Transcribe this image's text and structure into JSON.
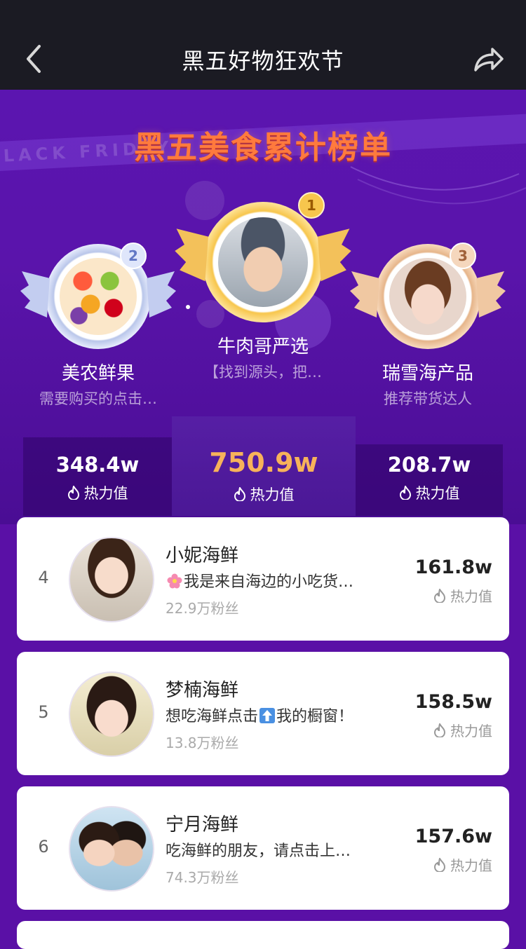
{
  "nav": {
    "title": "黑五好物狂欢节",
    "back_icon": "chevron-left-icon",
    "share_icon": "share-icon"
  },
  "hero": {
    "title": "黑五美食累计榜单",
    "banner_text": "BLACK FRIDAY",
    "podium": [
      {
        "rank": "2",
        "name": "美农鲜果",
        "desc": "需要购买的点击…"
      },
      {
        "rank": "1",
        "name": "牛肉哥严选",
        "desc": "【找到源头，把…"
      },
      {
        "rank": "3",
        "name": "瑞雪海产品",
        "desc": "推荐带货达人"
      }
    ]
  },
  "stats": [
    {
      "value": "348.4w",
      "label": "热力值"
    },
    {
      "value": "750.9w",
      "label": "热力值"
    },
    {
      "value": "208.7w",
      "label": "热力值"
    }
  ],
  "list": [
    {
      "rank": "4",
      "name": "小妮海鲜",
      "desc_prefix": "",
      "desc": "我是来自海边的小吃货…",
      "fans": "22.9万粉丝",
      "heat": "161.8w",
      "heat_label": "热力值"
    },
    {
      "rank": "5",
      "name": "梦楠海鲜",
      "desc": "想吃海鲜点击",
      "desc_after": "我的橱窗！",
      "fans": "13.8万粉丝",
      "heat": "158.5w",
      "heat_label": "热力值"
    },
    {
      "rank": "6",
      "name": "宁月海鲜",
      "desc": "吃海鲜的朋友，请点击上…",
      "fans": "74.3万粉丝",
      "heat": "157.6w",
      "heat_label": "热力值"
    }
  ],
  "colors": {
    "accent": "#ff7a3d",
    "gold": "#f3b43a",
    "bg_purple": "#5a10a6"
  }
}
